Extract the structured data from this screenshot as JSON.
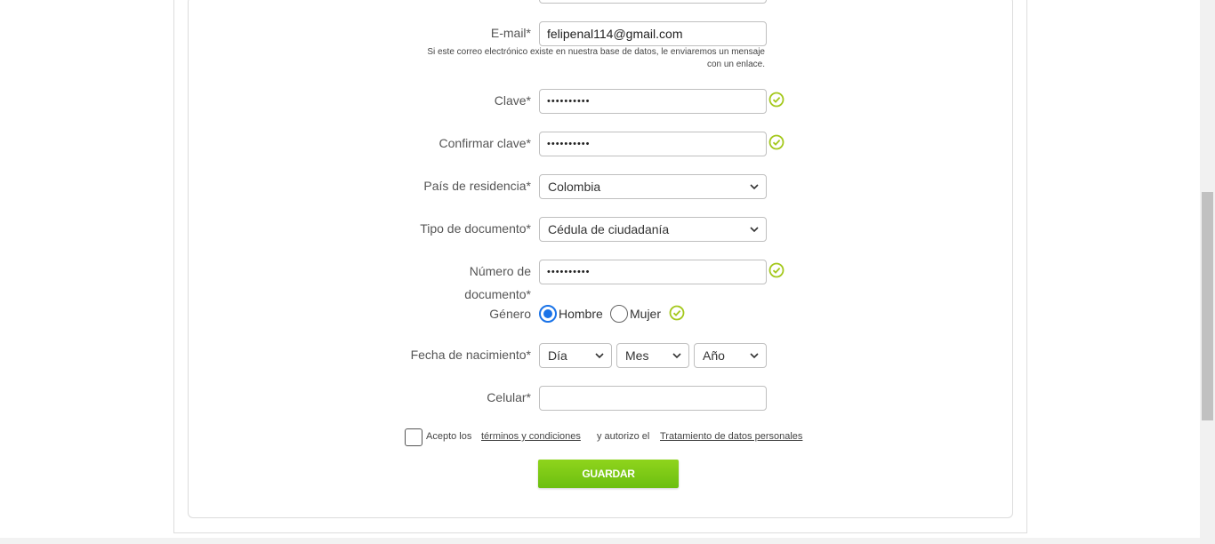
{
  "colors": {
    "accent_green": "#7cc818",
    "check_green": "#a4c81c",
    "radio_blue": "#1a73e8"
  },
  "form": {
    "email": {
      "label": "E-mail*",
      "value": "felipenal114@gmail.com",
      "hint": "Si este correo electrónico existe en nuestra base de datos, le enviaremos un mensaje con un enlace."
    },
    "password": {
      "label": "Clave*",
      "value": "••••••••••",
      "valid_icon": "check-circle-icon"
    },
    "confirm_password": {
      "label": "Confirmar clave*",
      "value": "••••••••••",
      "valid_icon": "check-circle-icon"
    },
    "country": {
      "label": "País de residencia*",
      "selected": "Colombia"
    },
    "document_type": {
      "label": "Tipo de documento*",
      "selected": "Cédula de ciudadanía"
    },
    "document_number": {
      "label_line1": "Número de",
      "label_line2": "documento*",
      "value": "••••••••••"
    },
    "gender": {
      "label": "Género",
      "options": [
        "Hombre",
        "Mujer"
      ],
      "selected": "Hombre"
    },
    "birth_date": {
      "label": "Fecha de nacimiento*",
      "day": "Día",
      "month": "Mes",
      "year": "Año"
    },
    "phone": {
      "label": "Celular*",
      "value": ""
    },
    "terms": {
      "prefix": "Acepto los",
      "terms_link": "términos y condiciones",
      "middle": "y autorizo el",
      "data_link": "Tratamiento de datos personales",
      "checked": false
    },
    "save_label": "GUARDAR"
  }
}
